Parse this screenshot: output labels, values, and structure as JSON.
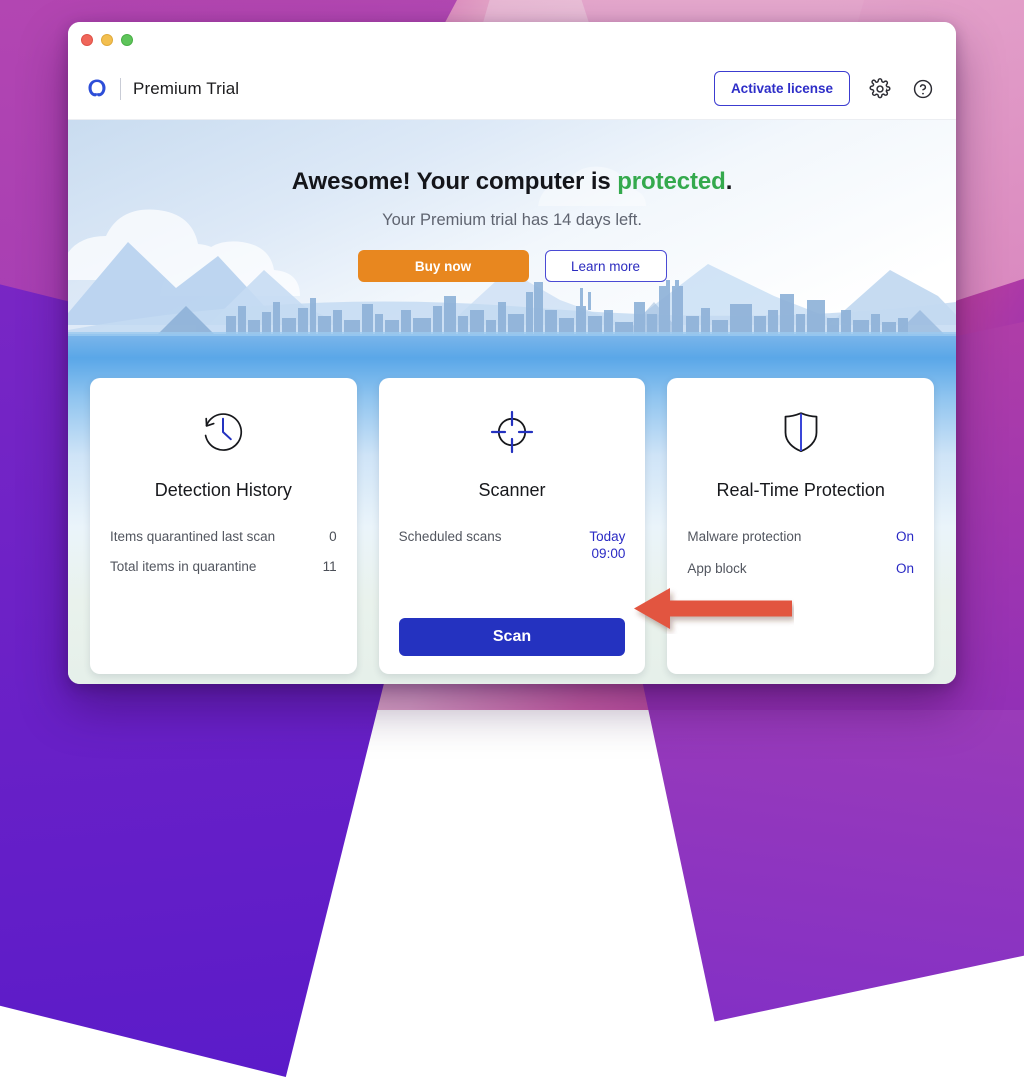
{
  "window": {
    "traffic_lights": [
      {
        "name": "close",
        "color": "#f0665a"
      },
      {
        "name": "minimize",
        "color": "#f3bf4f"
      },
      {
        "name": "zoom",
        "color": "#5ec45a"
      }
    ]
  },
  "header": {
    "logo_icon": "malwarebytes-logo-icon",
    "title": "Premium Trial",
    "activate_label": "Activate license",
    "settings_icon": "gear-icon",
    "help_icon": "help-circle-icon"
  },
  "hero": {
    "headline_prefix": "Awesome! Your computer is ",
    "headline_status": "protected",
    "headline_suffix": ".",
    "subtitle": "Your Premium trial has 14 days left.",
    "buy_label": "Buy now",
    "learn_label": "Learn more",
    "status_color": "#34a94d",
    "buy_color": "#e8871f"
  },
  "cards": [
    {
      "icon": "clock-history-icon",
      "title": "Detection History",
      "rows": [
        {
          "label": "Items quarantined last scan",
          "value": "0",
          "value_style": "plain"
        },
        {
          "label": "Total items in quarantine",
          "value": "11",
          "value_style": "plain"
        }
      ]
    },
    {
      "icon": "crosshair-target-icon",
      "title": "Scanner",
      "rows": [
        {
          "label": "Scheduled scans",
          "value": "Today\n09:00",
          "value_style": "blue"
        }
      ],
      "button_label": "Scan",
      "button_color": "#2432c0"
    },
    {
      "icon": "shield-icon",
      "title": "Real-Time Protection",
      "rows": [
        {
          "label": "Malware protection",
          "value": "On",
          "value_style": "blue"
        },
        {
          "label": "App block",
          "value": "On",
          "value_style": "blue"
        }
      ]
    }
  ],
  "annotation": {
    "arrow_icon": "left-arrow-annotation",
    "color": "#e2543f"
  }
}
